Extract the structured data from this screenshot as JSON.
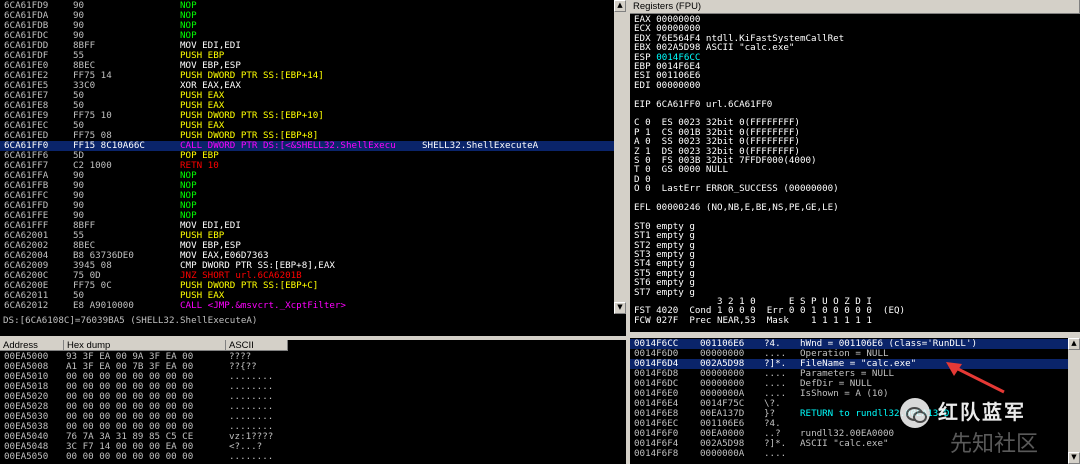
{
  "colors": {
    "bg": "#000000",
    "addr": "#c0c0c0",
    "hex": "#c0c0c0",
    "nop": "#00ff00",
    "push": "#ffff00",
    "call": "#ff00ff",
    "jcc": "#ff0000",
    "white": "#ffffff",
    "cyan": "#00ffff",
    "select": "#0a246a",
    "panel": "#d4d0c8"
  },
  "disasm": [
    {
      "addr": "6CA61FD9",
      "hex": "90",
      "mn": "NOP",
      "cls": "nop"
    },
    {
      "addr": "6CA61FDA",
      "hex": "90",
      "mn": "NOP",
      "cls": "nop"
    },
    {
      "addr": "6CA61FDB",
      "hex": "90",
      "mn": "NOP",
      "cls": "nop"
    },
    {
      "addr": "6CA61FDC",
      "hex": "90",
      "mn": "NOP",
      "cls": "nop"
    },
    {
      "addr": "6CA61FDD",
      "hex": "8BFF",
      "mn": "MOV EDI,EDI",
      "cls": "mov"
    },
    {
      "addr": "6CA61FDF",
      "hex": "55",
      "mn": "PUSH EBP",
      "cls": "push"
    },
    {
      "addr": "6CA61FE0",
      "hex": "8BEC",
      "mn": "MOV EBP,ESP",
      "cls": "mov"
    },
    {
      "addr": "6CA61FE2",
      "hex": "FF75 14",
      "mn": "PUSH DWORD PTR SS:[EBP+14]",
      "cls": "push"
    },
    {
      "addr": "6CA61FE5",
      "hex": "33C0",
      "mn": "XOR EAX,EAX",
      "cls": "mov"
    },
    {
      "addr": "6CA61FE7",
      "hex": "50",
      "mn": "PUSH EAX",
      "cls": "push"
    },
    {
      "addr": "6CA61FE8",
      "hex": "50",
      "mn": "PUSH EAX",
      "cls": "push"
    },
    {
      "addr": "6CA61FE9",
      "hex": "FF75 10",
      "mn": "PUSH DWORD PTR SS:[EBP+10]",
      "cls": "push"
    },
    {
      "addr": "6CA61FEC",
      "hex": "50",
      "mn": "PUSH EAX",
      "cls": "push"
    },
    {
      "addr": "6CA61FED",
      "hex": "FF75 08",
      "mn": "PUSH DWORD PTR SS:[EBP+8]",
      "cls": "push"
    },
    {
      "addr": "6CA61FF0",
      "hex": "FF15 8C10A66C",
      "mn": "CALL DWORD PTR DS:[<&SHELL32.ShellExecu",
      "cls": "call",
      "comment": "SHELL32.ShellExecuteA",
      "sel": true
    },
    {
      "addr": "6CA61FF6",
      "hex": "5D",
      "mn": "POP EBP",
      "cls": "push"
    },
    {
      "addr": "6CA61FF7",
      "hex": "C2 1000",
      "mn": "RETN 10",
      "cls": "ret"
    },
    {
      "addr": "6CA61FFA",
      "hex": "90",
      "mn": "NOP",
      "cls": "nop"
    },
    {
      "addr": "6CA61FFB",
      "hex": "90",
      "mn": "NOP",
      "cls": "nop"
    },
    {
      "addr": "6CA61FFC",
      "hex": "90",
      "mn": "NOP",
      "cls": "nop"
    },
    {
      "addr": "6CA61FFD",
      "hex": "90",
      "mn": "NOP",
      "cls": "nop"
    },
    {
      "addr": "6CA61FFE",
      "hex": "90",
      "mn": "NOP",
      "cls": "nop"
    },
    {
      "addr": "6CA61FFF",
      "hex": "8BFF",
      "mn": "MOV EDI,EDI",
      "cls": "mov"
    },
    {
      "addr": "6CA62001",
      "hex": "55",
      "mn": "PUSH EBP",
      "cls": "push"
    },
    {
      "addr": "6CA62002",
      "hex": "8BEC",
      "mn": "MOV EBP,ESP",
      "cls": "mov"
    },
    {
      "addr": "6CA62004",
      "hex": "B8 63736DE0",
      "mn": "MOV EAX,E06D7363",
      "cls": "mov"
    },
    {
      "addr": "6CA62009",
      "hex": "3945 08",
      "mn": "CMP DWORD PTR SS:[EBP+8],EAX",
      "cls": "mov"
    },
    {
      "addr": "6CA6200C",
      "hex": "75 0D",
      "mn": "JNZ SHORT url.6CA6201B",
      "cls": "jcc"
    },
    {
      "addr": "6CA6200E",
      "hex": "FF75 0C",
      "mn": "PUSH DWORD PTR SS:[EBP+C]",
      "cls": "push"
    },
    {
      "addr": "6CA62011",
      "hex": "50",
      "mn": "PUSH EAX",
      "cls": "push"
    },
    {
      "addr": "6CA62012",
      "hex": "E8 A9010000",
      "mn": "CALL <JMP.&msvcrt._XcptFilter>",
      "cls": "call"
    }
  ],
  "info_line": "DS:[6CA6108C]=76039BA5 (SHELL32.ShellExecuteA)",
  "registers": {
    "title": "Registers (FPU)",
    "lines": [
      {
        "t": "EAX 00000000"
      },
      {
        "t": "ECX 00000000"
      },
      {
        "t": "EDX 76E564F4 ntdll.KiFastSystemCallRet"
      },
      {
        "t": "EBX 002A5D98 ASCII \"calc.exe\""
      },
      {
        "t": "ESP 0014F6CC",
        "hl": true
      },
      {
        "t": "EBP 0014F6E4"
      },
      {
        "t": "ESI 001106E6"
      },
      {
        "t": "EDI 00000000"
      },
      {
        "t": ""
      },
      {
        "t": "EIP 6CA61FF0 url.6CA61FF0"
      },
      {
        "t": ""
      },
      {
        "t": "C 0  ES 0023 32bit 0(FFFFFFFF)"
      },
      {
        "t": "P 1  CS 001B 32bit 0(FFFFFFFF)"
      },
      {
        "t": "A 0  SS 0023 32bit 0(FFFFFFFF)"
      },
      {
        "t": "Z 1  DS 0023 32bit 0(FFFFFFFF)"
      },
      {
        "t": "S 0  FS 003B 32bit 7FFDF000(4000)"
      },
      {
        "t": "T 0  GS 0000 NULL"
      },
      {
        "t": "D 0"
      },
      {
        "t": "O 0  LastErr ERROR_SUCCESS (00000000)"
      },
      {
        "t": ""
      },
      {
        "t": "EFL 00000246 (NO,NB,E,BE,NS,PE,GE,LE)"
      },
      {
        "t": ""
      },
      {
        "t": "ST0 empty g"
      },
      {
        "t": "ST1 empty g"
      },
      {
        "t": "ST2 empty g"
      },
      {
        "t": "ST3 empty g"
      },
      {
        "t": "ST4 empty g"
      },
      {
        "t": "ST5 empty g"
      },
      {
        "t": "ST6 empty g"
      },
      {
        "t": "ST7 empty g"
      },
      {
        "t": "               3 2 1 0      E S P U O Z D I"
      },
      {
        "t": "FST 4020  Cond 1 0 0 0  Err 0 0 1 0 0 0 0 0  (EQ)"
      },
      {
        "t": "FCW 027F  Prec NEAR,53  Mask    1 1 1 1 1 1"
      }
    ]
  },
  "dump": {
    "headers": {
      "address": "Address",
      "hex": "Hex dump",
      "ascii": "ASCII"
    },
    "rows": [
      {
        "a": "00EA5000",
        "h": "93 3F EA 00 9A 3F EA 00",
        "s": "????"
      },
      {
        "a": "00EA5008",
        "h": "A1 3F EA 00 7B 3F EA 00",
        "s": "??{??"
      },
      {
        "a": "00EA5010",
        "h": "00 00 00 00 00 00 00 00",
        "s": "........"
      },
      {
        "a": "00EA5018",
        "h": "00 00 00 00 00 00 00 00",
        "s": "........"
      },
      {
        "a": "00EA5020",
        "h": "00 00 00 00 00 00 00 00",
        "s": "........"
      },
      {
        "a": "00EA5028",
        "h": "00 00 00 00 00 00 00 00",
        "s": "........"
      },
      {
        "a": "00EA5030",
        "h": "00 00 00 00 00 00 00 00",
        "s": "........"
      },
      {
        "a": "00EA5038",
        "h": "00 00 00 00 00 00 00 00",
        "s": "........"
      },
      {
        "a": "00EA5040",
        "h": "76 7A 3A 31 89 85 C5 CE",
        "s": "vz:1????"
      },
      {
        "a": "00EA5048",
        "h": "3C F7 14 00 00 00 EA 00",
        "s": "<?...?"
      },
      {
        "a": "00EA5050",
        "h": "00 00 00 00 00 00 00 00",
        "s": "........"
      }
    ]
  },
  "stack": {
    "rows": [
      {
        "a": "0014F6CC",
        "v": "001106E6",
        "s": "?4.",
        "c": "hWnd = 001106E6 (class='RunDLL')",
        "sel": true
      },
      {
        "a": "0014F6D0",
        "v": "00000000",
        "s": "....",
        "c": "Operation = NULL"
      },
      {
        "a": "0014F6D4",
        "v": "002A5D98",
        "s": "?]*.",
        "c": "FileName = \"calc.exe\"",
        "hl": true
      },
      {
        "a": "0014F6D8",
        "v": "00000000",
        "s": "....",
        "c": "Parameters = NULL"
      },
      {
        "a": "0014F6DC",
        "v": "00000000",
        "s": "....",
        "c": "DefDir = NULL"
      },
      {
        "a": "0014F6E0",
        "v": "0000000A",
        "s": "....",
        "c": "IsShown = A (10)"
      },
      {
        "a": "0014F6E4",
        "v": "0014F75C",
        "s": "\\?.",
        "c": ""
      },
      {
        "a": "0014F6E8",
        "v": "00EA137D",
        "s": "}?",
        "c": "RETURN to rundll32.00EA137D"
      },
      {
        "a": "0014F6EC",
        "v": "001106E6",
        "s": "?4.",
        "c": ""
      },
      {
        "a": "0014F6F0",
        "v": "00EA0000",
        "s": "..?",
        "c": "rundll32.00EA0000"
      },
      {
        "a": "0014F6F4",
        "v": "002A5D98",
        "s": "?]*.",
        "c": "ASCII \"calc.exe\""
      },
      {
        "a": "0014F6F8",
        "v": "0000000A",
        "s": "....",
        "c": ""
      }
    ]
  },
  "watermark": {
    "brand": "红队蓝军",
    "site": "先知社区"
  }
}
